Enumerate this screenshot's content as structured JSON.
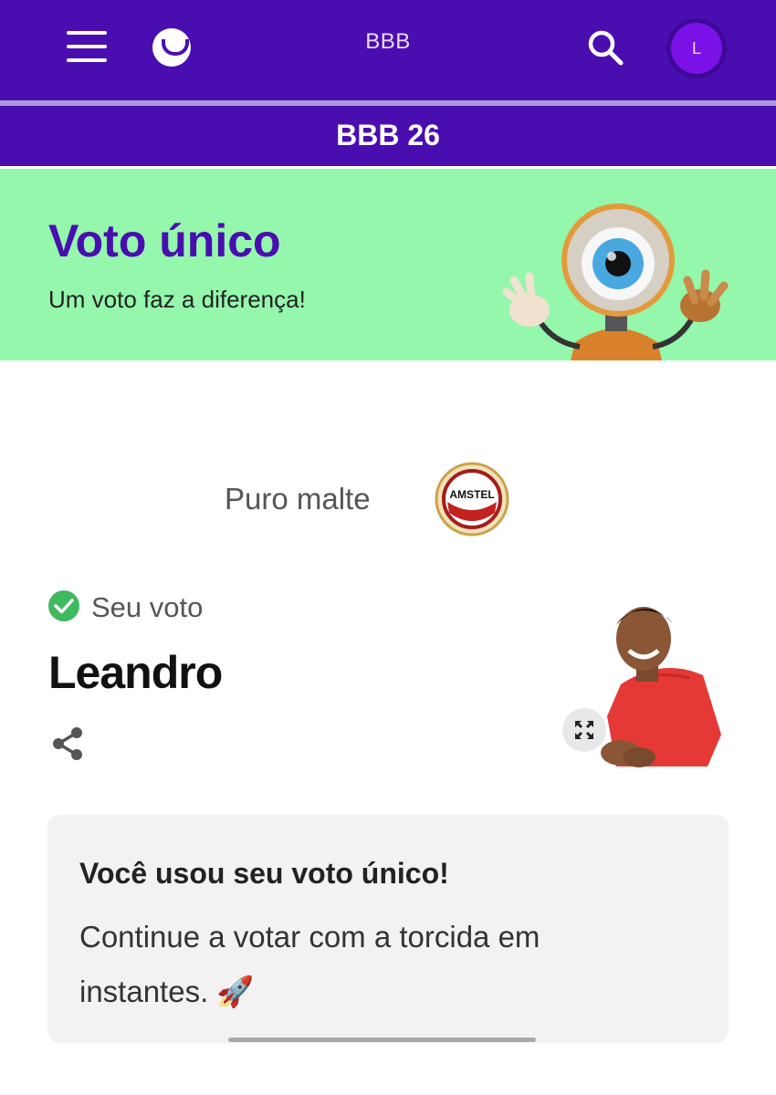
{
  "header": {
    "app_title": "BBB",
    "avatar_initial": "L",
    "brand_color": "#4a0db0",
    "icons": [
      "hamburger-menu-icon",
      "logo-smile-icon",
      "search-icon"
    ]
  },
  "subheader": {
    "title": "BBB 26"
  },
  "banner": {
    "title": "Voto único",
    "subtitle": "Um voto faz a diferença!",
    "background_color": "#94f7ab"
  },
  "sponsor": {
    "text": "Puro malte",
    "logo_text": "AMSTEL"
  },
  "vote": {
    "label": "Seu voto",
    "name": "Leandro",
    "status_color": "#3fb960"
  },
  "notice": {
    "title": "Você usou seu voto único!",
    "message": "Continue a votar com a torcida em instantes. 🚀"
  }
}
